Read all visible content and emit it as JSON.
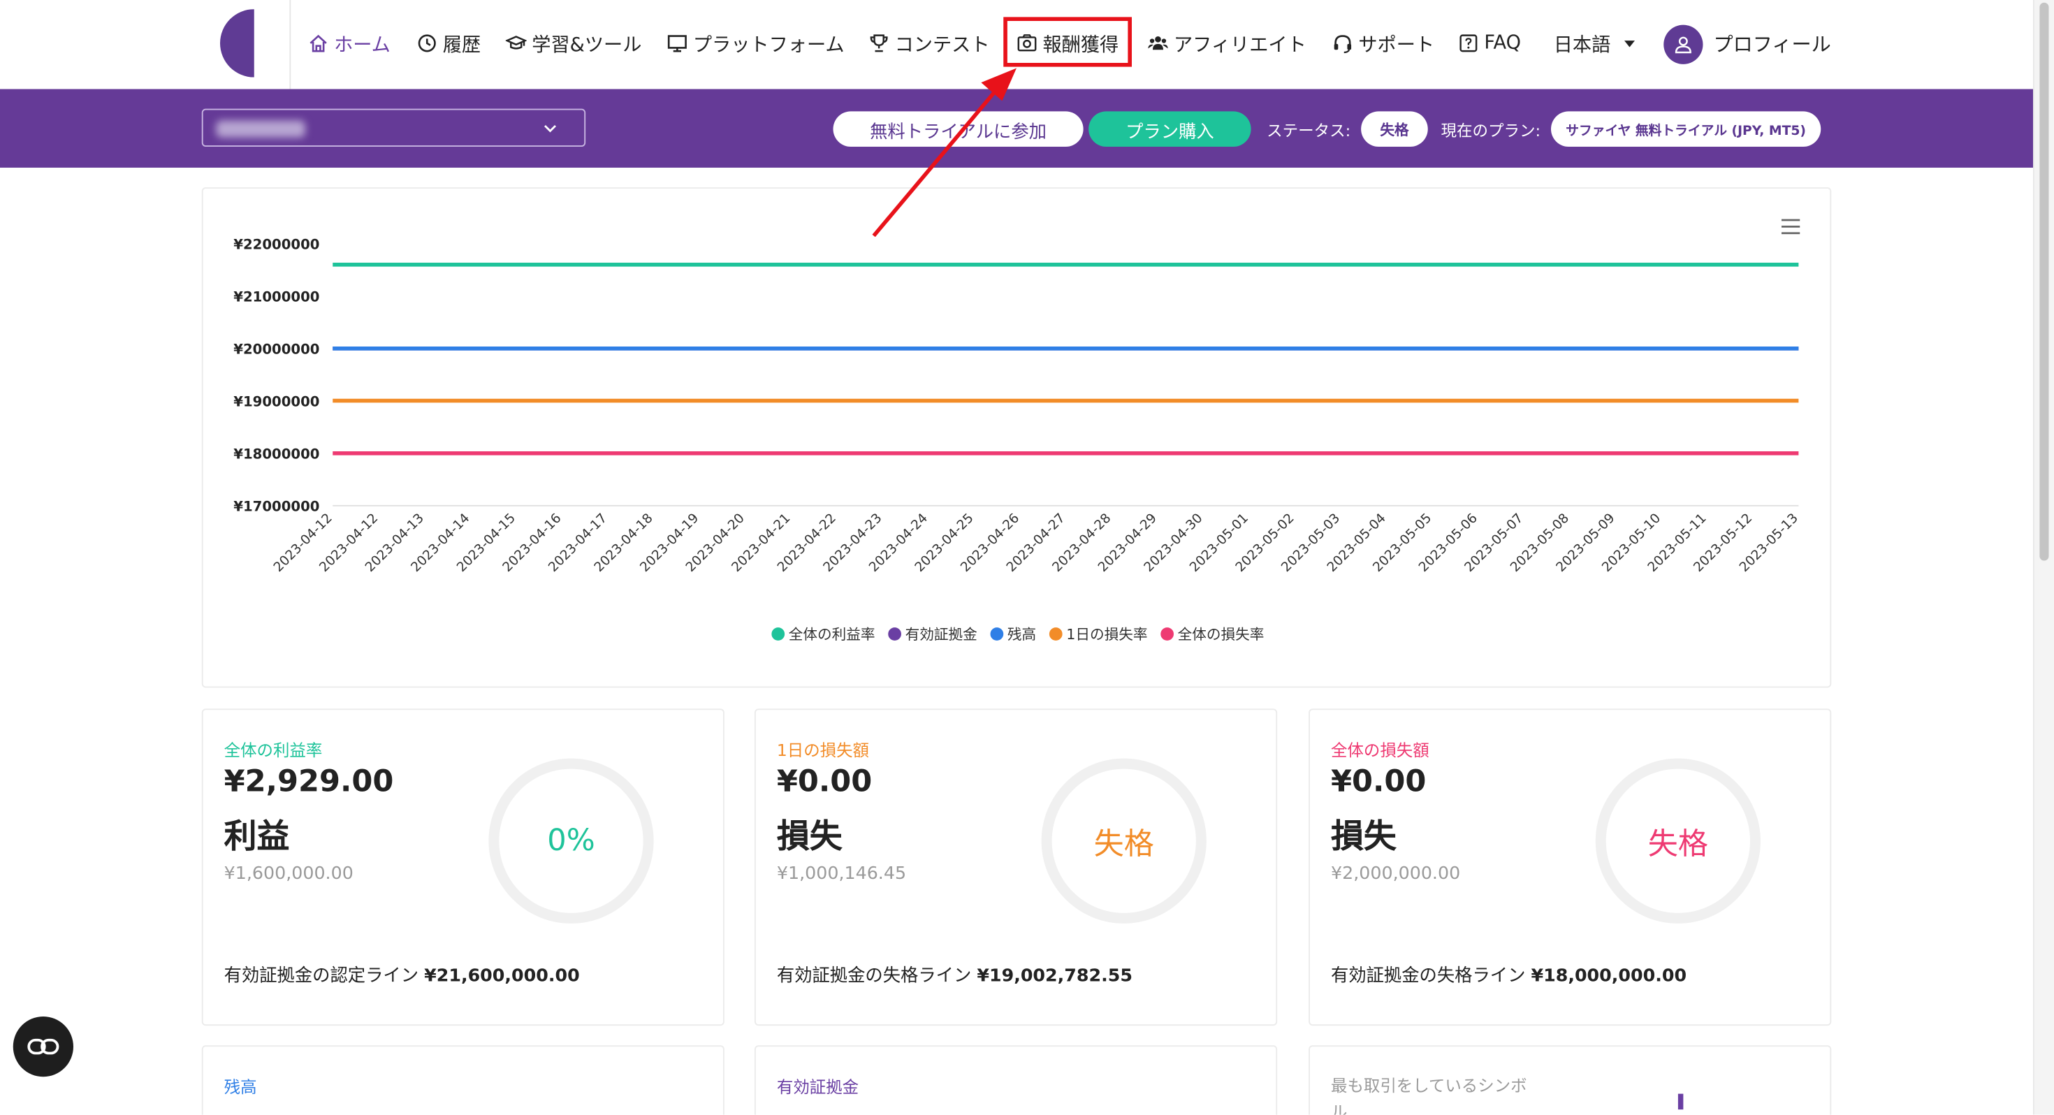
{
  "nav": {
    "items": [
      {
        "label": "ホーム",
        "icon": "home-icon",
        "active": true
      },
      {
        "label": "履歴",
        "icon": "clock-icon"
      },
      {
        "label": "学習&ツール",
        "icon": "graduation-cap-icon"
      },
      {
        "label": "プラットフォーム",
        "icon": "monitor-icon"
      },
      {
        "label": "コンテスト",
        "icon": "trophy-icon"
      },
      {
        "label": "報酬獲得",
        "icon": "camera-reward-icon",
        "highlighted": true
      },
      {
        "label": "アフィリエイト",
        "icon": "users-icon"
      },
      {
        "label": "サポート",
        "icon": "headset-icon"
      },
      {
        "label": "FAQ",
        "icon": "question-square-icon"
      }
    ],
    "language": "日本語",
    "profile": "プロフィール"
  },
  "toolbar": {
    "free_trial_button": "無料トライアルに参加",
    "buy_plan_button": "プラン購入",
    "status_label": "ステータス:",
    "status_value": "失格",
    "current_plan_label": "現在のプラン:",
    "current_plan_value": "サファイヤ 無料トライアル (JPY, MT5)"
  },
  "chart_data": {
    "type": "line",
    "x": [
      "2023-04-12",
      "2023-04-12",
      "2023-04-13",
      "2023-04-14",
      "2023-04-15",
      "2023-04-16",
      "2023-04-17",
      "2023-04-18",
      "2023-04-19",
      "2023-04-20",
      "2023-04-21",
      "2023-04-22",
      "2023-04-23",
      "2023-04-24",
      "2023-04-25",
      "2023-04-26",
      "2023-04-27",
      "2023-04-28",
      "2023-04-29",
      "2023-04-30",
      "2023-05-01",
      "2023-05-02",
      "2023-05-03",
      "2023-05-04",
      "2023-05-05",
      "2023-05-06",
      "2023-05-07",
      "2023-05-08",
      "2023-05-09",
      "2023-05-10",
      "2023-05-11",
      "2023-05-12",
      "2023-05-13"
    ],
    "yticks": [
      "¥22000000",
      "¥21000000",
      "¥20000000",
      "¥19000000",
      "¥18000000",
      "¥17000000"
    ],
    "ylim": [
      17000000,
      22000000
    ],
    "series": [
      {
        "name": "全体の利益率",
        "color": "#1ec39a",
        "value": 21600000
      },
      {
        "name": "有効証拠金",
        "color": "#6a3fa3",
        "value": 20000000
      },
      {
        "name": "残高",
        "color": "#2f7fe6",
        "value": 20000000
      },
      {
        "name": "1日の損失率",
        "color": "#f28c28",
        "value": 19002782.55
      },
      {
        "name": "全体の損失率",
        "color": "#ee3a72",
        "value": 18000000
      }
    ],
    "legend_position": "bottom",
    "grid": false
  },
  "stats": [
    {
      "title": "全体の利益率",
      "title_color": "#1ec39a",
      "value": "¥2,929.00",
      "sub": "利益",
      "small": "¥1,600,000.00",
      "ring_text": "0%",
      "ring_color": "#1ec39a",
      "line_label": "有効証拠金の認定ライン",
      "line_value": "¥21,600,000.00"
    },
    {
      "title": "1日の損失額",
      "title_color": "#f28c28",
      "value": "¥0.00",
      "sub": "損失",
      "small": "¥1,000,146.45",
      "ring_text": "失格",
      "ring_color": "#f28c28",
      "line_label": "有効証拠金の失格ライン",
      "line_value": "¥19,002,782.55"
    },
    {
      "title": "全体の損失額",
      "title_color": "#ee3a72",
      "value": "¥0.00",
      "sub": "損失",
      "small": "¥2,000,000.00",
      "ring_text": "失格",
      "ring_color": "#ee3a72",
      "line_label": "有効証拠金の失格ライン",
      "line_value": "¥18,000,000.00"
    }
  ],
  "stats_row2": [
    {
      "title": "残高",
      "title_color": "#2f7fe6"
    },
    {
      "title": "有効証拠金",
      "title_color": "#6a3fa3"
    },
    {
      "title": "最も取引をしているシンボル",
      "title_color": "#9a9a9a"
    }
  ]
}
